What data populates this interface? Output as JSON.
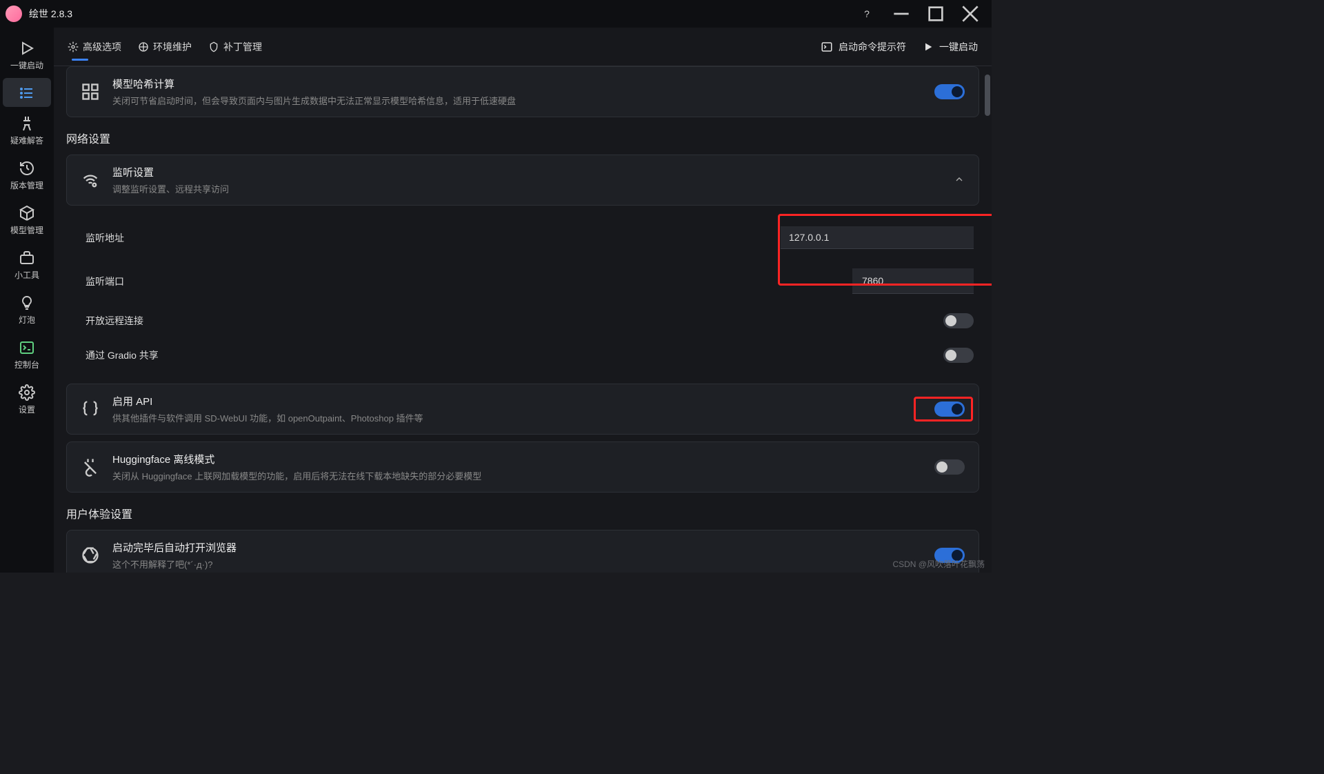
{
  "window": {
    "title": "绘世 2.8.3"
  },
  "sidebar": {
    "items": [
      {
        "label": "一键启动"
      },
      {
        "label": ""
      },
      {
        "label": "疑难解答"
      },
      {
        "label": "版本管理"
      },
      {
        "label": "模型管理"
      },
      {
        "label": "小工具"
      },
      {
        "label": "灯泡"
      },
      {
        "label": "控制台"
      },
      {
        "label": "设置"
      }
    ]
  },
  "topbar": {
    "tabs": [
      {
        "label": "高级选项"
      },
      {
        "label": "环境维护"
      },
      {
        "label": "补丁管理"
      }
    ],
    "cmd_prompt": "启动命令提示符",
    "one_click": "一键启动"
  },
  "cards": {
    "hash": {
      "title": "模型哈希计算",
      "desc": "关闭可节省启动时间，但会导致页面内与图片生成数据中无法正常显示模型哈希信息，适用于低速硬盘"
    },
    "listen": {
      "title": "监听设置",
      "desc": "调整监听设置、远程共享访问"
    },
    "api": {
      "title": "启用 API",
      "desc": "供其他插件与软件调用 SD-WebUI 功能，如 openOutpaint、Photoshop 插件等"
    },
    "hf": {
      "title": "Huggingface 离线模式",
      "desc": "关闭从 Huggingface 上联网加载模型的功能，启用后将无法在线下载本地缺失的部分必要模型"
    },
    "browser": {
      "title": "启动完毕后自动打开浏览器",
      "desc": "这个不用解释了吧(*´·д·)?"
    }
  },
  "sections": {
    "network": "网络设置",
    "ux": "用户体验设置"
  },
  "fields": {
    "listen_addr": {
      "label": "监听地址",
      "value": "127.0.0.1"
    },
    "listen_port": {
      "label": "监听端口",
      "value": "7860"
    },
    "remote": {
      "label": "开放远程连接"
    },
    "gradio": {
      "label": "通过 Gradio 共享"
    }
  },
  "toggles": {
    "hash": true,
    "remote": false,
    "gradio": false,
    "api": true,
    "hf": false,
    "browser": true
  },
  "watermark": "CSDN @风吹落叶花飘荡"
}
